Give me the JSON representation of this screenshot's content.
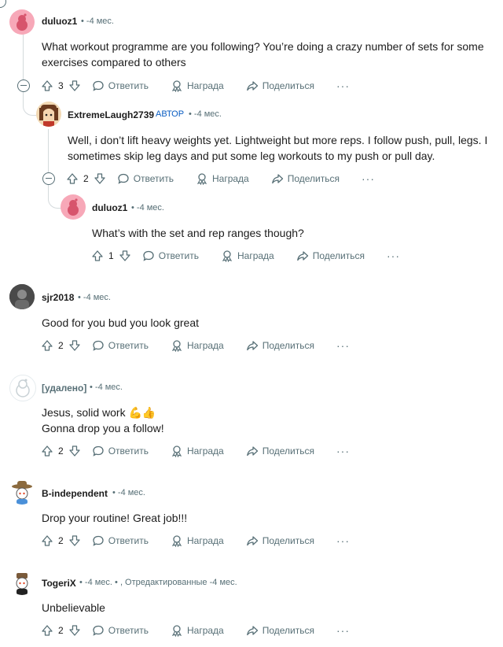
{
  "actions": {
    "reply": "Ответить",
    "award": "Награда",
    "share": "Поделиться"
  },
  "comments": [
    {
      "user": "duluoz1",
      "meta": "• -4 мес.",
      "body": [
        "What workout programme are you following? You’re doing a crazy number of sets for some",
        "exercises compared to others"
      ],
      "votes": "3"
    },
    {
      "user": "ExtremeLaugh2739",
      "author_tag": "АВТОР",
      "meta": "• -4 мес.",
      "body": [
        "Well, i don’t lift heavy weights yet. Lightweight but more reps. I follow push, pull, legs. I",
        "sometimes skip leg days and put some leg workouts to my push or pull day."
      ],
      "votes": "2"
    },
    {
      "user": "duluoz1",
      "meta": "• -4 мес.",
      "body": [
        "What’s with the set and rep ranges though?"
      ],
      "votes": "1"
    },
    {
      "user": "sjr2018",
      "meta": "• -4 мес.",
      "body": [
        "Good for you bud you look great"
      ],
      "votes": "2"
    },
    {
      "user": "[удалено]",
      "meta": "• -4 мес.",
      "body": [
        "Jesus, solid work 💪👍",
        "Gonna drop you a follow!"
      ],
      "votes": "2"
    },
    {
      "user": "B-independent",
      "meta": "• -4 мес.",
      "body": [
        "Drop your routine! Great job!!!"
      ],
      "votes": "2"
    },
    {
      "user": "TogeriX",
      "meta": "• -4 мес. • , Отредактированные -4 мес.",
      "body": [
        "Unbelievable"
      ],
      "votes": "2"
    }
  ],
  "icons": {
    "upvote": "arrow-up-icon",
    "downvote": "arrow-down-icon",
    "reply": "speech-bubble-icon",
    "award": "award-icon",
    "share": "share-arrow-icon",
    "more": "ellipsis-icon",
    "collapse": "collapse-minus-icon"
  },
  "colors": {
    "meta": "#576f76",
    "author": "#0a5dc2",
    "thread_line": "#d4dadc",
    "avatar_pink": "#f7a8b8"
  }
}
